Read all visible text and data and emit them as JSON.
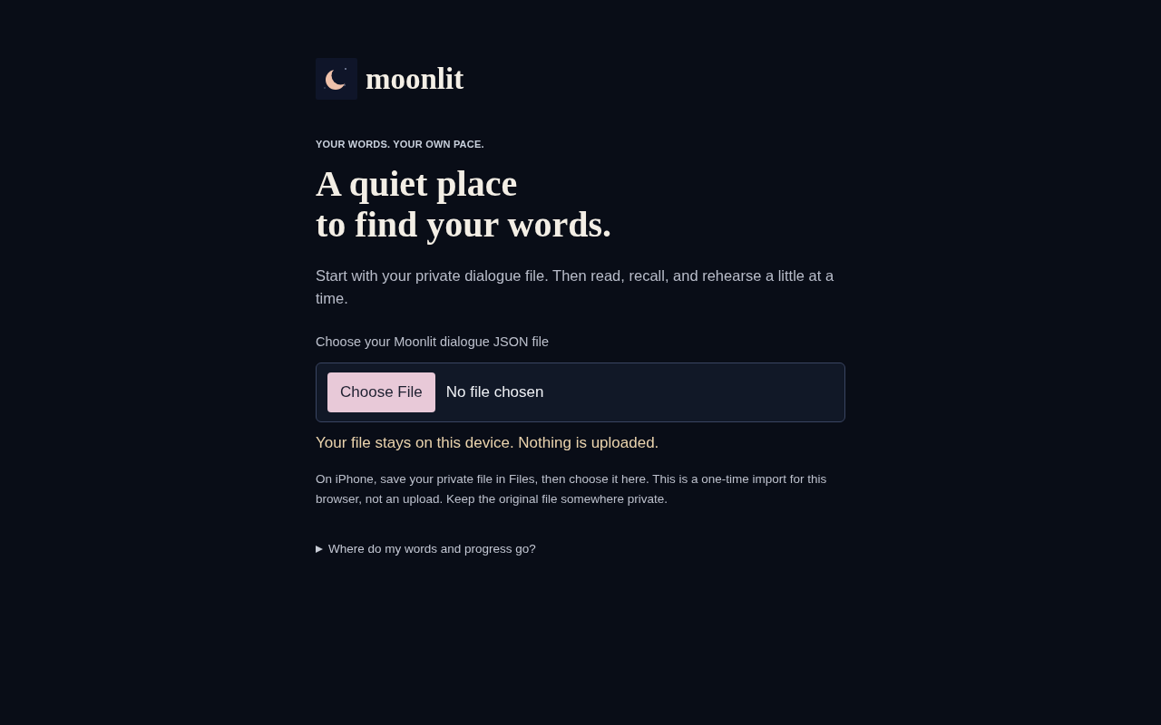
{
  "brand": {
    "name": "moonlit"
  },
  "hero": {
    "eyebrow": "YOUR WORDS. YOUR OWN PACE.",
    "headline": [
      "A quiet place",
      "to find your words."
    ],
    "intro": "Start with your private dialogue file. Then read, recall, and rehearse a little at a time."
  },
  "import": {
    "label": "Choose your Moonlit dialogue JSON file",
    "button": "Choose File",
    "status": "No file chosen",
    "notice": "Your file stays on this device. Nothing is uploaded.",
    "help": "On iPhone, save your private file in Files, then choose it here. This is a one-time import for this browser, not an upload. Keep the original file somewhere private."
  },
  "details": {
    "summary": "Where do my words and progress go?",
    "expanded": false
  }
}
